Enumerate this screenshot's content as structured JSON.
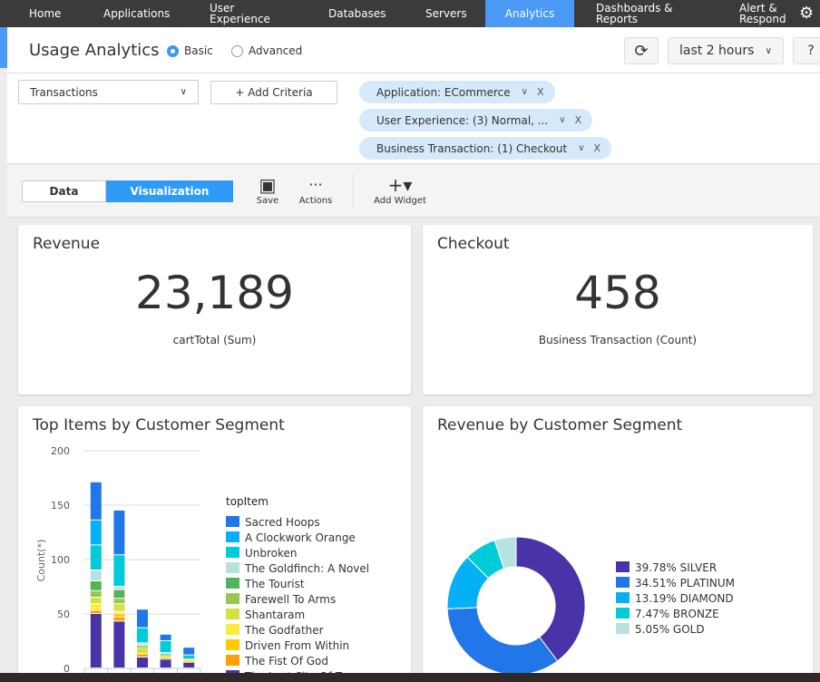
{
  "nav": {
    "items": [
      "Home",
      "Applications",
      "User Experience",
      "Databases",
      "Servers",
      "Analytics",
      "Dashboards & Reports",
      "Alert & Respond"
    ],
    "active": "Analytics",
    "settings_icon": "gear-icon"
  },
  "header": {
    "title": "Usage Analytics",
    "mode_basic": "Basic",
    "mode_advanced": "Advanced",
    "selected_mode": "Basic",
    "time_range": "last 2 hours",
    "help": "?"
  },
  "filters": {
    "source": "Transactions",
    "add_criteria": "+ Add Criteria",
    "chips": [
      "Application: ECommerce",
      "User Experience: (3) Normal, ...",
      "Business Transaction: (1) Checkout"
    ],
    "chip_close": "X"
  },
  "toolbar": {
    "data_tab": "Data",
    "viz_tab": "Visualization",
    "active_tab": "Visualization",
    "save": "Save",
    "actions": "Actions",
    "add_widget": "Add Widget"
  },
  "widgets": {
    "revenue": {
      "title": "Revenue",
      "value": "23,189",
      "label": "cartTotal (Sum)"
    },
    "checkout": {
      "title": "Checkout",
      "value": "458",
      "label": "Business Transaction (Count)"
    },
    "top_items": {
      "title": "Top Items by Customer Segment"
    },
    "revenue_segment": {
      "title": "Revenue by Customer Segment"
    }
  },
  "chart_data": [
    {
      "type": "bar",
      "stacked": true,
      "ylabel": "Count(*)",
      "ylim": [
        0,
        200
      ],
      "yticks": [
        "0",
        "50",
        "100",
        "150",
        "200"
      ],
      "grid": true,
      "legend_title": "topItem",
      "legend_placement": "right",
      "categories": [
        "",
        "",
        "",
        "",
        ""
      ],
      "series": [
        {
          "name": "The Lost City Of Z",
          "color": "#4a32a8",
          "values": [
            50,
            43,
            10,
            8,
            5
          ]
        },
        {
          "name": "The Fist Of God",
          "color": "#ffa000",
          "values": [
            3,
            4,
            3,
            1,
            1
          ]
        },
        {
          "name": "Driven From Within",
          "color": "#ffc800",
          "values": [
            0,
            3,
            0,
            0,
            1
          ]
        },
        {
          "name": "The Godfather",
          "color": "#ffeb3b",
          "values": [
            6,
            2,
            0,
            1,
            1
          ]
        },
        {
          "name": "Shantaram",
          "color": "#d4e13f",
          "values": [
            6,
            7,
            6,
            1,
            0
          ]
        },
        {
          "name": "Farewell To Arms",
          "color": "#96c850",
          "values": [
            6,
            5,
            1,
            1,
            0
          ]
        },
        {
          "name": "The Tourist",
          "color": "#52b45a",
          "values": [
            9,
            8,
            1,
            1,
            0
          ]
        },
        {
          "name": "The Goldfinch: A Novel",
          "color": "#b8e2df",
          "values": [
            10,
            3,
            2,
            1,
            0
          ]
        },
        {
          "name": "Unbroken",
          "color": "#00cbd8",
          "values": [
            23,
            29,
            14,
            11,
            4
          ]
        },
        {
          "name": "A Clockwork Orange",
          "color": "#05b0f5",
          "values": [
            23,
            0,
            0,
            0,
            0
          ]
        },
        {
          "name": "Sacred Hoops",
          "color": "#2176e8",
          "values": [
            35,
            41,
            17,
            6,
            7
          ]
        }
      ]
    },
    {
      "type": "pie",
      "donut": true,
      "legend_placement": "right",
      "slices": [
        {
          "label": "39.78% SILVER",
          "value": 39.78,
          "color": "#4a32a8"
        },
        {
          "label": "34.51% PLATINUM",
          "value": 34.51,
          "color": "#2176e8"
        },
        {
          "label": "13.19% DIAMOND",
          "value": 13.19,
          "color": "#05b0f5"
        },
        {
          "label": "7.47% BRONZE",
          "value": 7.47,
          "color": "#00cbd8"
        },
        {
          "label": "5.05% GOLD",
          "value": 5.05,
          "color": "#b8e2df"
        }
      ]
    }
  ]
}
